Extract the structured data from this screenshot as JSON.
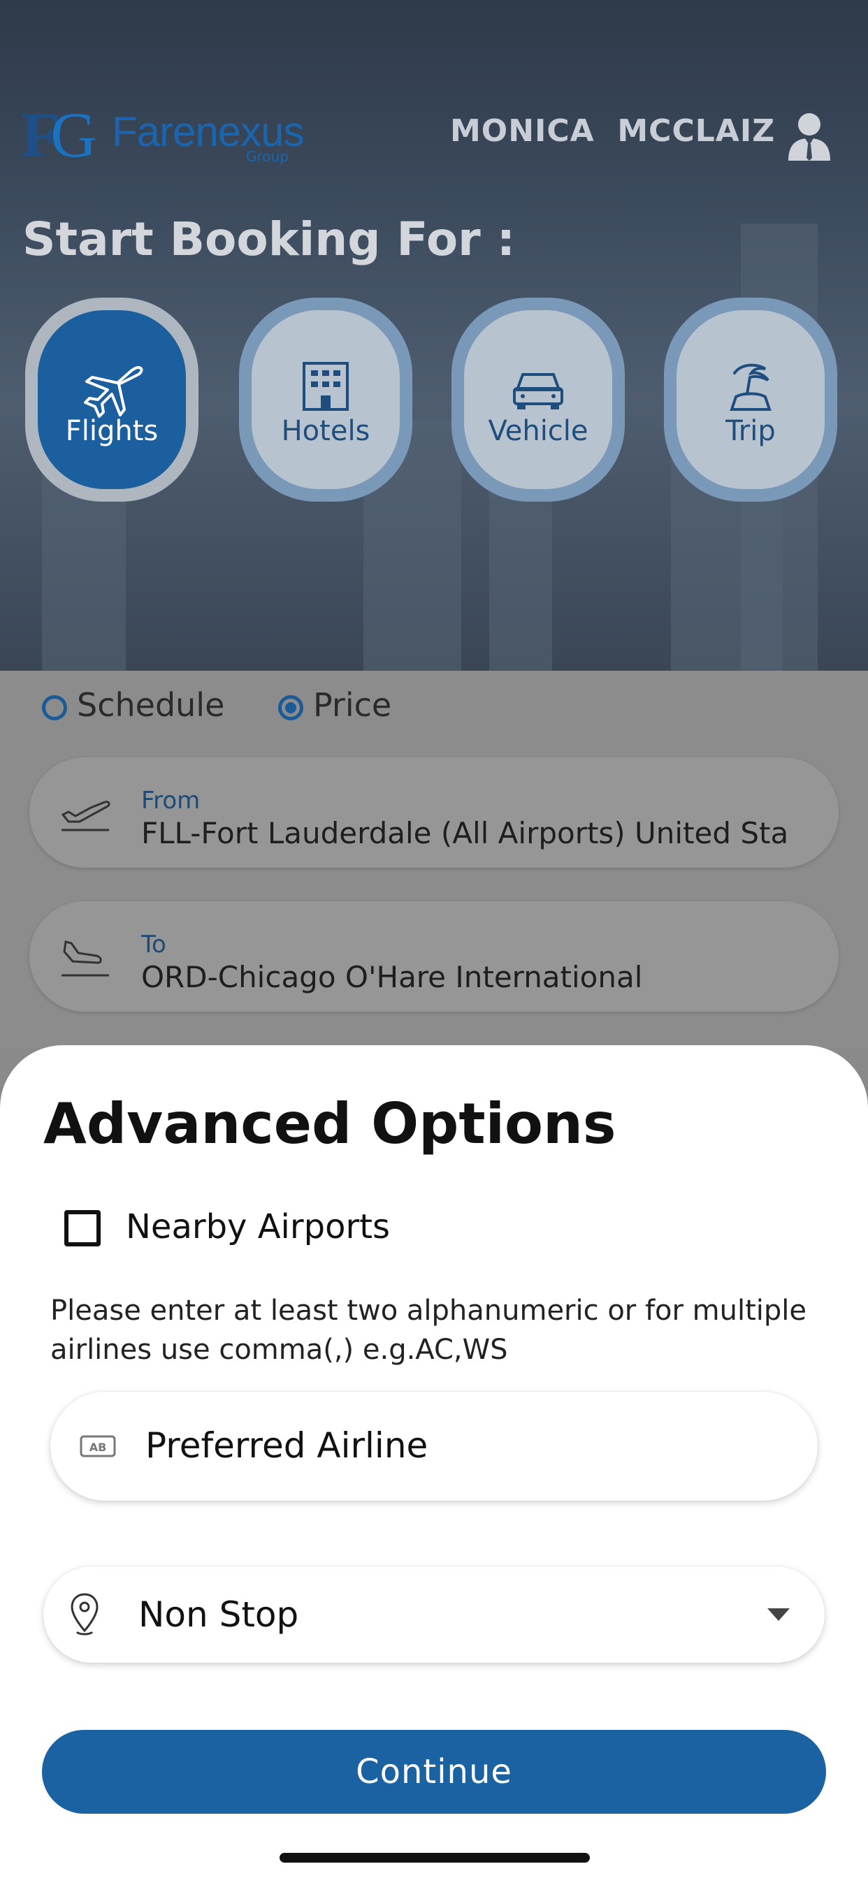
{
  "header": {
    "logo_mark_f": "F",
    "logo_mark_g": "G",
    "logo_name": "Farenexus",
    "logo_sub": "Group",
    "user_name": "MONICA  MCCLAIZ",
    "user_icon": "user-suit-icon"
  },
  "booking": {
    "title": "Start Booking For :",
    "categories": [
      {
        "label": "Flights",
        "icon": "plane-icon",
        "active": true
      },
      {
        "label": "Hotels",
        "icon": "hotel-icon",
        "active": false
      },
      {
        "label": "Vehicle",
        "icon": "car-icon",
        "active": false
      },
      {
        "label": "Trip",
        "icon": "palm-tree-icon",
        "active": false
      }
    ]
  },
  "search": {
    "sort_options": [
      {
        "label": "Schedule",
        "selected": false
      },
      {
        "label": "Price",
        "selected": true
      }
    ],
    "from": {
      "label": "From",
      "value": "FLL-Fort Lauderdale (All Airports) United Sta"
    },
    "to": {
      "label": "To",
      "value": "ORD-Chicago O'Hare International"
    }
  },
  "advanced": {
    "title": "Advanced Options",
    "nearby_airports_label": "Nearby Airports",
    "nearby_airports_checked": false,
    "hint": "Please enter at least two alphanumeric or for multiple airlines use comma(,) e.g.AC,WS",
    "preferred_airline_placeholder": "Preferred Airline",
    "stops_value": "Non Stop",
    "continue_label": "Continue"
  },
  "colors": {
    "accent": "#1a62a1",
    "header_bg": "#3b4a5c"
  }
}
